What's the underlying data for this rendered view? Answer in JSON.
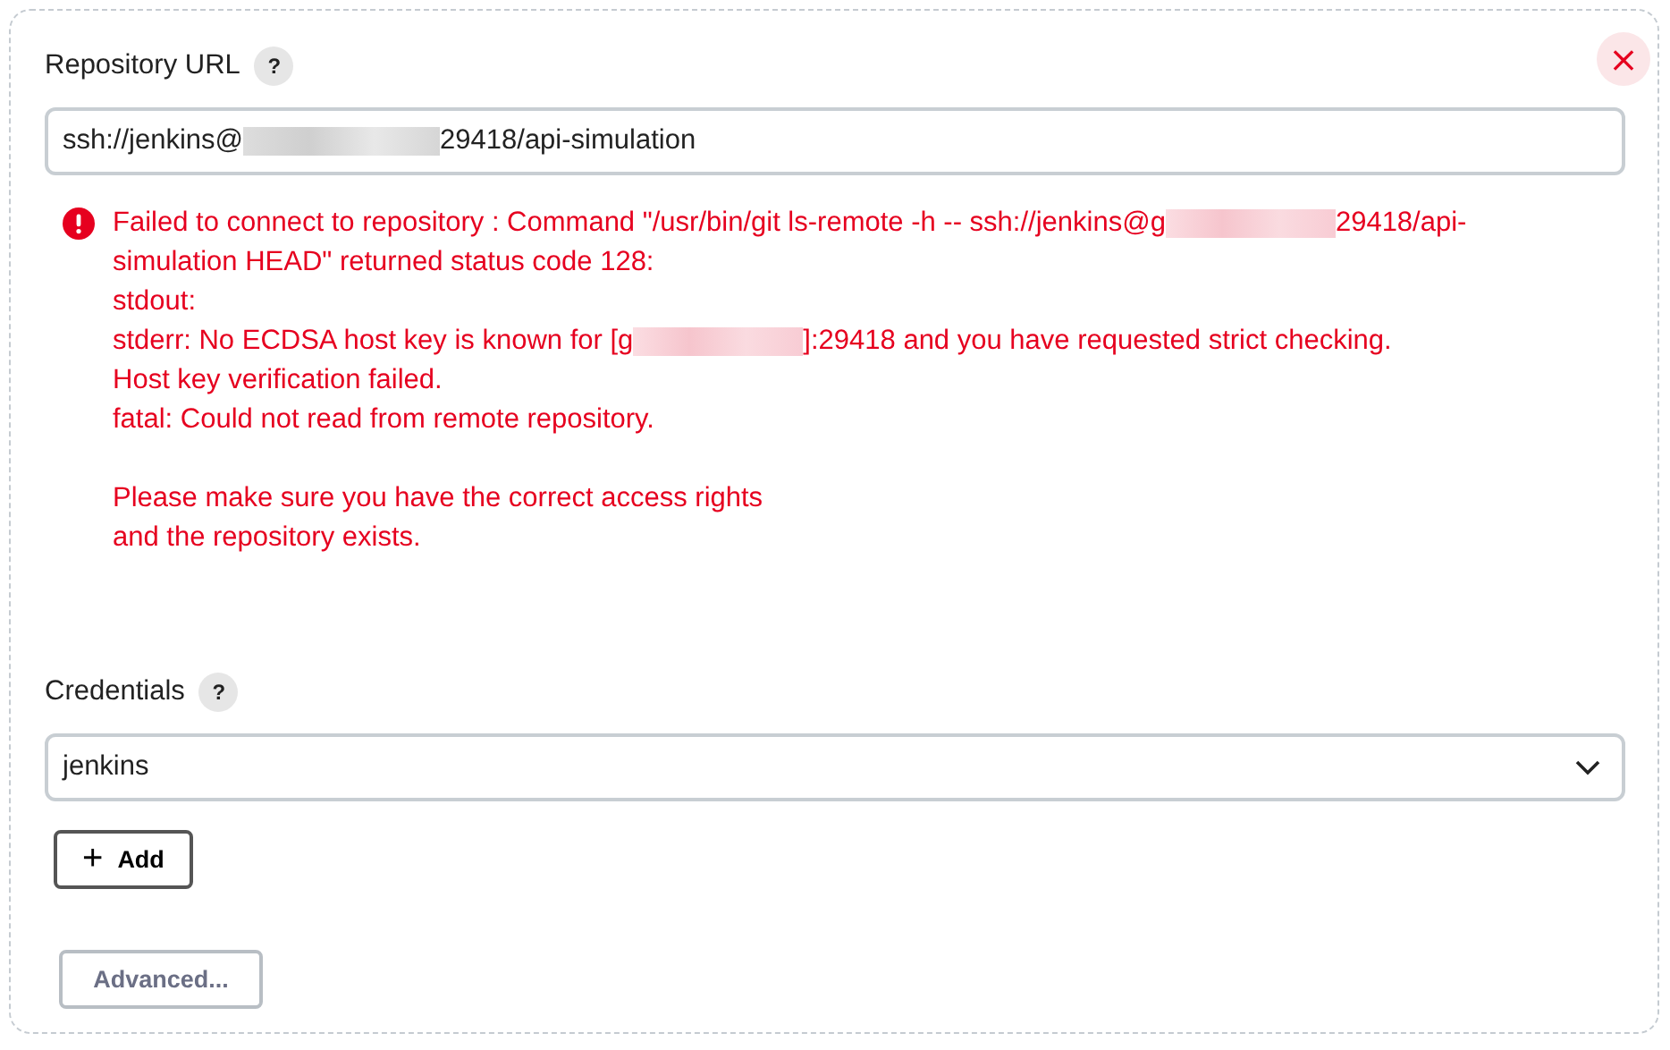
{
  "repository_url": {
    "label": "Repository URL",
    "help": "?",
    "value_parts": [
      {
        "kind": "text",
        "text": "ssh://jenkins@"
      },
      {
        "kind": "redacted"
      },
      {
        "kind": "text",
        "text": "29418/api-simulation"
      }
    ]
  },
  "close_button": "×",
  "error": {
    "lines": [
      [
        {
          "kind": "text",
          "text": "Failed to connect to repository : Command \"/usr/bin/git ls-remote -h -- ssh://jenkins@g"
        },
        {
          "kind": "redacted"
        },
        {
          "kind": "text",
          "text": "29418/api-"
        }
      ],
      [
        {
          "kind": "text",
          "text": "simulation HEAD\" returned status code 128:"
        }
      ],
      [
        {
          "kind": "text",
          "text": "stdout:"
        }
      ],
      [
        {
          "kind": "text",
          "text": "stderr: No ECDSA host key is known for [g"
        },
        {
          "kind": "redacted"
        },
        {
          "kind": "text",
          "text": "]:29418 and you have requested strict checking."
        }
      ],
      [
        {
          "kind": "text",
          "text": "Host key verification failed."
        }
      ],
      [
        {
          "kind": "text",
          "text": "fatal: Could not read from remote repository."
        }
      ]
    ],
    "hint_lines": [
      "Please make sure you have the correct access rights",
      "and the repository exists."
    ]
  },
  "credentials": {
    "label": "Credentials",
    "help": "?",
    "value": "jenkins"
  },
  "add_button": {
    "icon": "+",
    "label": "Add"
  },
  "advanced_button": "Advanced..."
}
